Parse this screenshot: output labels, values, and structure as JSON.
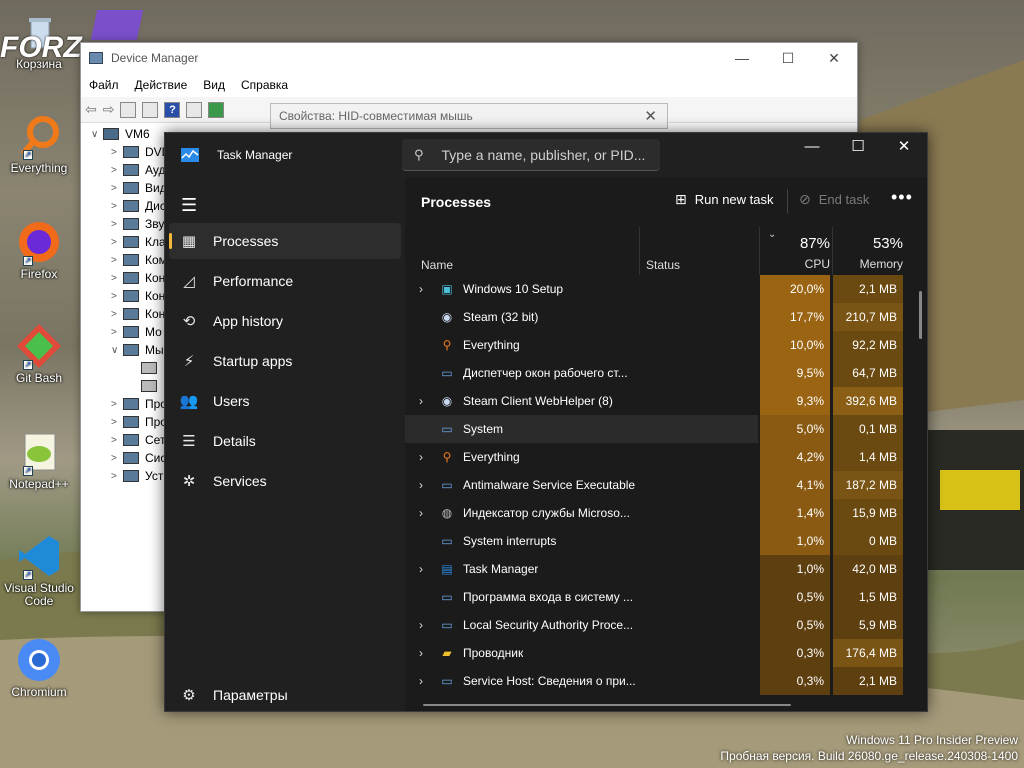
{
  "desktop": {
    "icons": [
      {
        "label": "Корзина",
        "icon": "recycle-bin-icon"
      },
      {
        "label": "Everything",
        "icon": "everything-icon"
      },
      {
        "label": "Firefox",
        "icon": "firefox-icon"
      },
      {
        "label": "Git Bash",
        "icon": "git-bash-icon"
      },
      {
        "label": "Notepad++",
        "icon": "notepadpp-icon"
      },
      {
        "label": "Visual Studio Code",
        "icon": "vscode-icon"
      },
      {
        "label": "Chromium",
        "icon": "chromium-icon"
      }
    ],
    "wallpaper_text": "FORZA HORIZ"
  },
  "device_manager": {
    "title": "Device Manager",
    "menu": [
      "Файл",
      "Действие",
      "Вид",
      "Справка"
    ],
    "tree": [
      {
        "label": "VM6",
        "exp": "∨"
      },
      {
        "label": "DVD",
        "exp": ">"
      },
      {
        "label": "Ауд",
        "exp": ">"
      },
      {
        "label": "Вид",
        "exp": ">"
      },
      {
        "label": "Дис",
        "exp": ">"
      },
      {
        "label": "Зву",
        "exp": ">"
      },
      {
        "label": "Кла",
        "exp": ">"
      },
      {
        "label": "Ком",
        "exp": ">"
      },
      {
        "label": "Кон",
        "exp": ">"
      },
      {
        "label": "Кон",
        "exp": ">"
      },
      {
        "label": "Кон",
        "exp": ">"
      },
      {
        "label": "Мо",
        "exp": ">"
      },
      {
        "label": "Мы",
        "exp": "∨"
      },
      {
        "label": "",
        "exp": ""
      },
      {
        "label": "",
        "exp": ""
      },
      {
        "label": "Про",
        "exp": ">"
      },
      {
        "label": "Про",
        "exp": ">"
      },
      {
        "label": "Сет",
        "exp": ">"
      },
      {
        "label": "Сис",
        "exp": ">"
      },
      {
        "label": "Уст",
        "exp": ">"
      }
    ]
  },
  "properties_dialog": {
    "title": "Свойства: HID-совместимая мышь"
  },
  "task_manager": {
    "title": "Task Manager",
    "search_placeholder": "Type a name, publisher, or PID...",
    "nav": [
      {
        "label": "Processes",
        "icon": "processes-icon",
        "active": true
      },
      {
        "label": "Performance",
        "icon": "performance-icon"
      },
      {
        "label": "App history",
        "icon": "app-history-icon"
      },
      {
        "label": "Startup apps",
        "icon": "startup-apps-icon"
      },
      {
        "label": "Users",
        "icon": "users-icon"
      },
      {
        "label": "Details",
        "icon": "details-icon"
      },
      {
        "label": "Services",
        "icon": "services-icon"
      }
    ],
    "settings_label": "Параметры",
    "page_title": "Processes",
    "run_new_task": "Run new task",
    "end_task": "End task",
    "columns": {
      "name": "Name",
      "status": "Status",
      "cpu_pct": "87%",
      "cpu": "CPU",
      "mem_pct": "53%",
      "mem": "Memory"
    },
    "processes": [
      {
        "name": "Windows 10 Setup",
        "expand": true,
        "icon": "setup-icon",
        "cpu": "20,0%",
        "mem": "2,1 MB",
        "cpu_heat": "#9a6412",
        "mem_heat": "#6b4a12"
      },
      {
        "name": "Steam (32 bit)",
        "expand": false,
        "icon": "steam-icon",
        "cpu": "17,7%",
        "mem": "210,7 MB",
        "cpu_heat": "#9a6412",
        "mem_heat": "#7a5414"
      },
      {
        "name": "Everything",
        "expand": false,
        "icon": "everything-icon",
        "cpu": "10,0%",
        "mem": "92,2 MB",
        "cpu_heat": "#9a6412",
        "mem_heat": "#6b4a12"
      },
      {
        "name": "Диспетчер окон рабочего ст...",
        "expand": false,
        "icon": "window-icon",
        "cpu": "9,5%",
        "mem": "64,7 MB",
        "cpu_heat": "#9a6412",
        "mem_heat": "#6b4a12"
      },
      {
        "name": "Steam Client WebHelper (8)",
        "expand": true,
        "icon": "steam-icon",
        "cpu": "9,3%",
        "mem": "392,6 MB",
        "cpu_heat": "#9a6412",
        "mem_heat": "#8a5e14"
      },
      {
        "name": "System",
        "expand": false,
        "icon": "window-icon",
        "cpu": "5,0%",
        "mem": "0,1 MB",
        "cpu_heat": "#8a5a12",
        "mem_heat": "#6b4a12",
        "highlight": true
      },
      {
        "name": "Everything",
        "expand": true,
        "icon": "everything-icon",
        "cpu": "4,2%",
        "mem": "1,4 MB",
        "cpu_heat": "#8a5a12",
        "mem_heat": "#6b4a12"
      },
      {
        "name": "Antimalware Service Executable",
        "expand": true,
        "icon": "window-icon",
        "cpu": "4,1%",
        "mem": "187,2 MB",
        "cpu_heat": "#8a5a12",
        "mem_heat": "#7a5414"
      },
      {
        "name": "Индексатор службы Microso...",
        "expand": true,
        "icon": "indexer-icon",
        "cpu": "1,4%",
        "mem": "15,9 MB",
        "cpu_heat": "#8a5a12",
        "mem_heat": "#6b4a12"
      },
      {
        "name": "System interrupts",
        "expand": false,
        "icon": "window-icon",
        "cpu": "1,0%",
        "mem": "0 MB",
        "cpu_heat": "#8a5a12",
        "mem_heat": "#6b4a12"
      },
      {
        "name": "Task Manager",
        "expand": true,
        "icon": "taskmgr-icon",
        "cpu": "1,0%",
        "mem": "42,0 MB",
        "cpu_heat": "#5e3f10",
        "mem_heat": "#5e3f10"
      },
      {
        "name": "Программа входа в систему ...",
        "expand": false,
        "icon": "window-icon",
        "cpu": "0,5%",
        "mem": "1,5 MB",
        "cpu_heat": "#5e3f10",
        "mem_heat": "#5e3f10"
      },
      {
        "name": "Local Security Authority Proce...",
        "expand": true,
        "icon": "window-icon",
        "cpu": "0,5%",
        "mem": "5,9 MB",
        "cpu_heat": "#5e3f10",
        "mem_heat": "#5e3f10"
      },
      {
        "name": "Проводник",
        "expand": true,
        "icon": "folder-icon",
        "cpu": "0,3%",
        "mem": "176,4 MB",
        "cpu_heat": "#5e3f10",
        "mem_heat": "#7a5414"
      },
      {
        "name": "Service Host: Сведения о при...",
        "expand": true,
        "icon": "window-icon",
        "cpu": "0,3%",
        "mem": "2,1 MB",
        "cpu_heat": "#5e3f10",
        "mem_heat": "#5e3f10"
      }
    ]
  },
  "watermark": {
    "line1": "Windows 11 Pro Insider Preview",
    "line2": "Пробная версия. Build 26080.ge_release.240308-1400"
  }
}
